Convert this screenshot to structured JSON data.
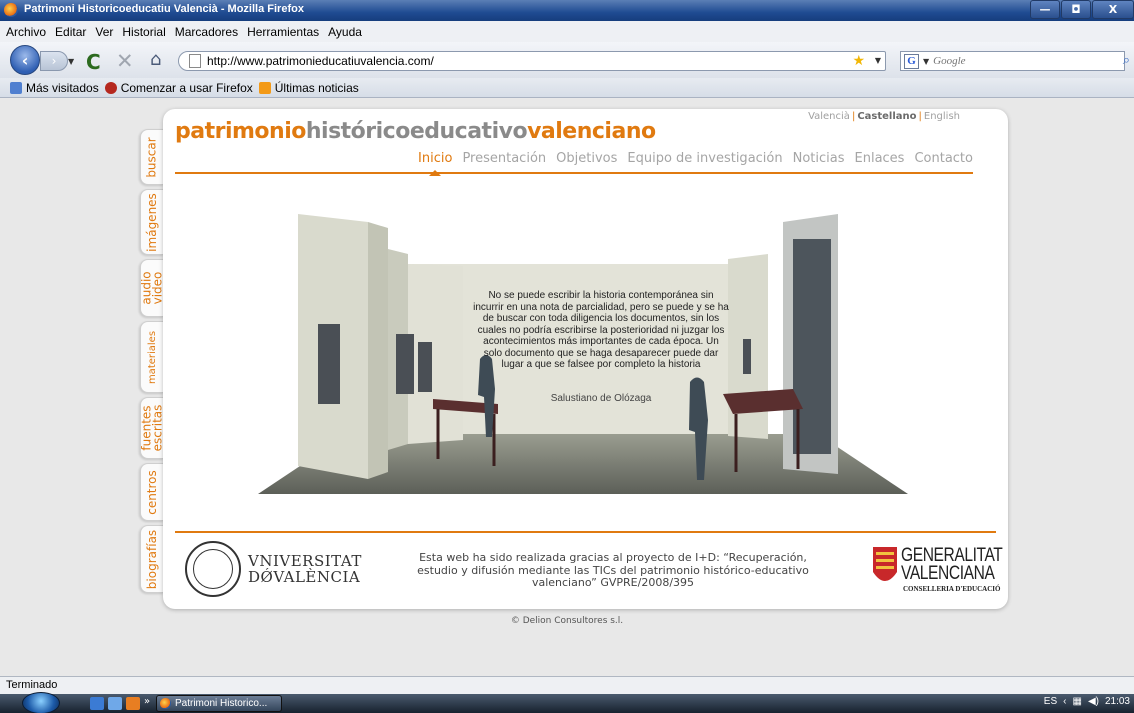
{
  "window": {
    "title": "Patrimoni Historicoeducatiu Valencià - Mozilla Firefox",
    "min_glyph": "—",
    "max_glyph": "◘",
    "close_glyph": "X"
  },
  "menubar": [
    "Archivo",
    "Editar",
    "Ver",
    "Historial",
    "Marcadores",
    "Herramientas",
    "Ayuda"
  ],
  "toolbar": {
    "url": "http://www.patrimonieducatiuvalencia.com/",
    "search_placeholder": "Google",
    "back_glyph": "‹",
    "forward_glyph": "›",
    "reload_glyph": "C",
    "stop_glyph": "✕",
    "home_glyph": "⌂",
    "star_glyph": "★",
    "search_engine_glyph": "G",
    "search_go_glyph": "⌕"
  },
  "bookmarks": [
    "Más visitados",
    "Comenzar a usar Firefox",
    "Últimas noticias"
  ],
  "site": {
    "logo": {
      "part1": "patrimonio",
      "part2": "históricoeducativo",
      "part3": "valenciano"
    },
    "languages": [
      "Valencià",
      "Castellano",
      "English"
    ],
    "nav": [
      "Inicio",
      "Presentación",
      "Objetivos",
      "Equipo de investigación",
      "Noticias",
      "Enlaces",
      "Contacto"
    ],
    "side_tabs": [
      "buscar",
      "imágenes",
      "audio video",
      "materiales",
      "fuentes escritas",
      "centros",
      "biografías"
    ],
    "quote": "No se puede escribir la historia contemporánea sin incurrir en una nota de parcialidad, pero se puede y se ha de buscar con toda diligencia los documentos, sin los cuales no podría escribirse la posterioridad ni juzgar los acontecimientos más importantes de cada época. Un solo documento que se haga desaparecer puede dar lugar a que se falsee por completo la historia",
    "quote_author": "Salustiano de Olózaga",
    "university": {
      "line1": "VNIVERSITAT",
      "line2": "DǾVALÈNCIA"
    },
    "credit": "Esta web ha sido realizada gracias al proyecto de I+D: “Recuperación, estudio y difusión mediante las TICs del patrimonio histórico-educativo valenciano” GVPRE/2008/395",
    "generalitat": {
      "line1": "GENERALITAT",
      "line2": "VALENCIANA",
      "sub": "CONSELLERIA D'EDUCACIÓ"
    },
    "copyright": "© Delion Consultores s.l."
  },
  "status": "Terminado",
  "taskbar": {
    "overflow_glyph": "»",
    "item": "Patrimoni Historico...",
    "lang": "ES",
    "time": "21:03"
  },
  "colors": {
    "accent": "#e07a10",
    "grey_text": "#8a8a8a"
  }
}
